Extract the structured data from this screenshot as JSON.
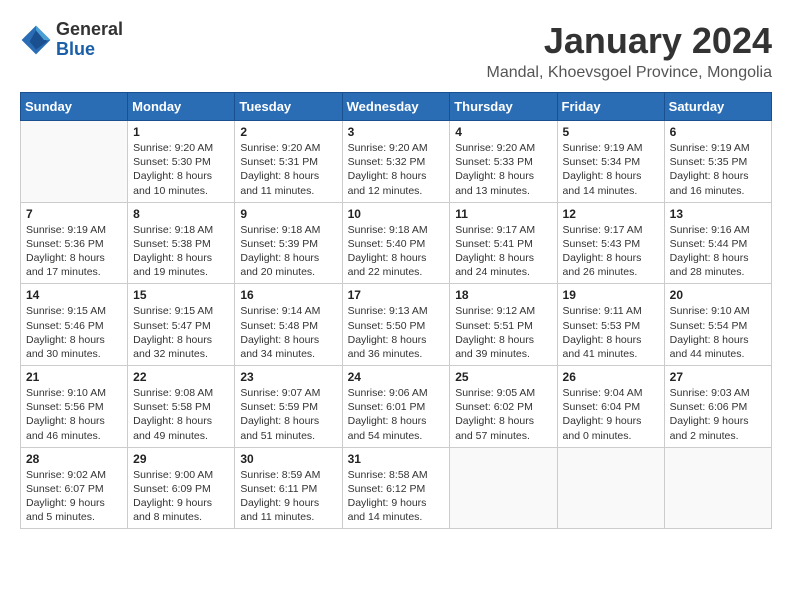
{
  "header": {
    "logo_general": "General",
    "logo_blue": "Blue",
    "title": "January 2024",
    "subtitle": "Mandal, Khoevsgoel Province, Mongolia"
  },
  "days_of_week": [
    "Sunday",
    "Monday",
    "Tuesday",
    "Wednesday",
    "Thursday",
    "Friday",
    "Saturday"
  ],
  "weeks": [
    [
      {
        "day": "",
        "info": ""
      },
      {
        "day": "1",
        "info": "Sunrise: 9:20 AM\nSunset: 5:30 PM\nDaylight: 8 hours\nand 10 minutes."
      },
      {
        "day": "2",
        "info": "Sunrise: 9:20 AM\nSunset: 5:31 PM\nDaylight: 8 hours\nand 11 minutes."
      },
      {
        "day": "3",
        "info": "Sunrise: 9:20 AM\nSunset: 5:32 PM\nDaylight: 8 hours\nand 12 minutes."
      },
      {
        "day": "4",
        "info": "Sunrise: 9:20 AM\nSunset: 5:33 PM\nDaylight: 8 hours\nand 13 minutes."
      },
      {
        "day": "5",
        "info": "Sunrise: 9:19 AM\nSunset: 5:34 PM\nDaylight: 8 hours\nand 14 minutes."
      },
      {
        "day": "6",
        "info": "Sunrise: 9:19 AM\nSunset: 5:35 PM\nDaylight: 8 hours\nand 16 minutes."
      }
    ],
    [
      {
        "day": "7",
        "info": "Sunrise: 9:19 AM\nSunset: 5:36 PM\nDaylight: 8 hours\nand 17 minutes."
      },
      {
        "day": "8",
        "info": "Sunrise: 9:18 AM\nSunset: 5:38 PM\nDaylight: 8 hours\nand 19 minutes."
      },
      {
        "day": "9",
        "info": "Sunrise: 9:18 AM\nSunset: 5:39 PM\nDaylight: 8 hours\nand 20 minutes."
      },
      {
        "day": "10",
        "info": "Sunrise: 9:18 AM\nSunset: 5:40 PM\nDaylight: 8 hours\nand 22 minutes."
      },
      {
        "day": "11",
        "info": "Sunrise: 9:17 AM\nSunset: 5:41 PM\nDaylight: 8 hours\nand 24 minutes."
      },
      {
        "day": "12",
        "info": "Sunrise: 9:17 AM\nSunset: 5:43 PM\nDaylight: 8 hours\nand 26 minutes."
      },
      {
        "day": "13",
        "info": "Sunrise: 9:16 AM\nSunset: 5:44 PM\nDaylight: 8 hours\nand 28 minutes."
      }
    ],
    [
      {
        "day": "14",
        "info": "Sunrise: 9:15 AM\nSunset: 5:46 PM\nDaylight: 8 hours\nand 30 minutes."
      },
      {
        "day": "15",
        "info": "Sunrise: 9:15 AM\nSunset: 5:47 PM\nDaylight: 8 hours\nand 32 minutes."
      },
      {
        "day": "16",
        "info": "Sunrise: 9:14 AM\nSunset: 5:48 PM\nDaylight: 8 hours\nand 34 minutes."
      },
      {
        "day": "17",
        "info": "Sunrise: 9:13 AM\nSunset: 5:50 PM\nDaylight: 8 hours\nand 36 minutes."
      },
      {
        "day": "18",
        "info": "Sunrise: 9:12 AM\nSunset: 5:51 PM\nDaylight: 8 hours\nand 39 minutes."
      },
      {
        "day": "19",
        "info": "Sunrise: 9:11 AM\nSunset: 5:53 PM\nDaylight: 8 hours\nand 41 minutes."
      },
      {
        "day": "20",
        "info": "Sunrise: 9:10 AM\nSunset: 5:54 PM\nDaylight: 8 hours\nand 44 minutes."
      }
    ],
    [
      {
        "day": "21",
        "info": "Sunrise: 9:10 AM\nSunset: 5:56 PM\nDaylight: 8 hours\nand 46 minutes."
      },
      {
        "day": "22",
        "info": "Sunrise: 9:08 AM\nSunset: 5:58 PM\nDaylight: 8 hours\nand 49 minutes."
      },
      {
        "day": "23",
        "info": "Sunrise: 9:07 AM\nSunset: 5:59 PM\nDaylight: 8 hours\nand 51 minutes."
      },
      {
        "day": "24",
        "info": "Sunrise: 9:06 AM\nSunset: 6:01 PM\nDaylight: 8 hours\nand 54 minutes."
      },
      {
        "day": "25",
        "info": "Sunrise: 9:05 AM\nSunset: 6:02 PM\nDaylight: 8 hours\nand 57 minutes."
      },
      {
        "day": "26",
        "info": "Sunrise: 9:04 AM\nSunset: 6:04 PM\nDaylight: 9 hours\nand 0 minutes."
      },
      {
        "day": "27",
        "info": "Sunrise: 9:03 AM\nSunset: 6:06 PM\nDaylight: 9 hours\nand 2 minutes."
      }
    ],
    [
      {
        "day": "28",
        "info": "Sunrise: 9:02 AM\nSunset: 6:07 PM\nDaylight: 9 hours\nand 5 minutes."
      },
      {
        "day": "29",
        "info": "Sunrise: 9:00 AM\nSunset: 6:09 PM\nDaylight: 9 hours\nand 8 minutes."
      },
      {
        "day": "30",
        "info": "Sunrise: 8:59 AM\nSunset: 6:11 PM\nDaylight: 9 hours\nand 11 minutes."
      },
      {
        "day": "31",
        "info": "Sunrise: 8:58 AM\nSunset: 6:12 PM\nDaylight: 9 hours\nand 14 minutes."
      },
      {
        "day": "",
        "info": ""
      },
      {
        "day": "",
        "info": ""
      },
      {
        "day": "",
        "info": ""
      }
    ]
  ]
}
